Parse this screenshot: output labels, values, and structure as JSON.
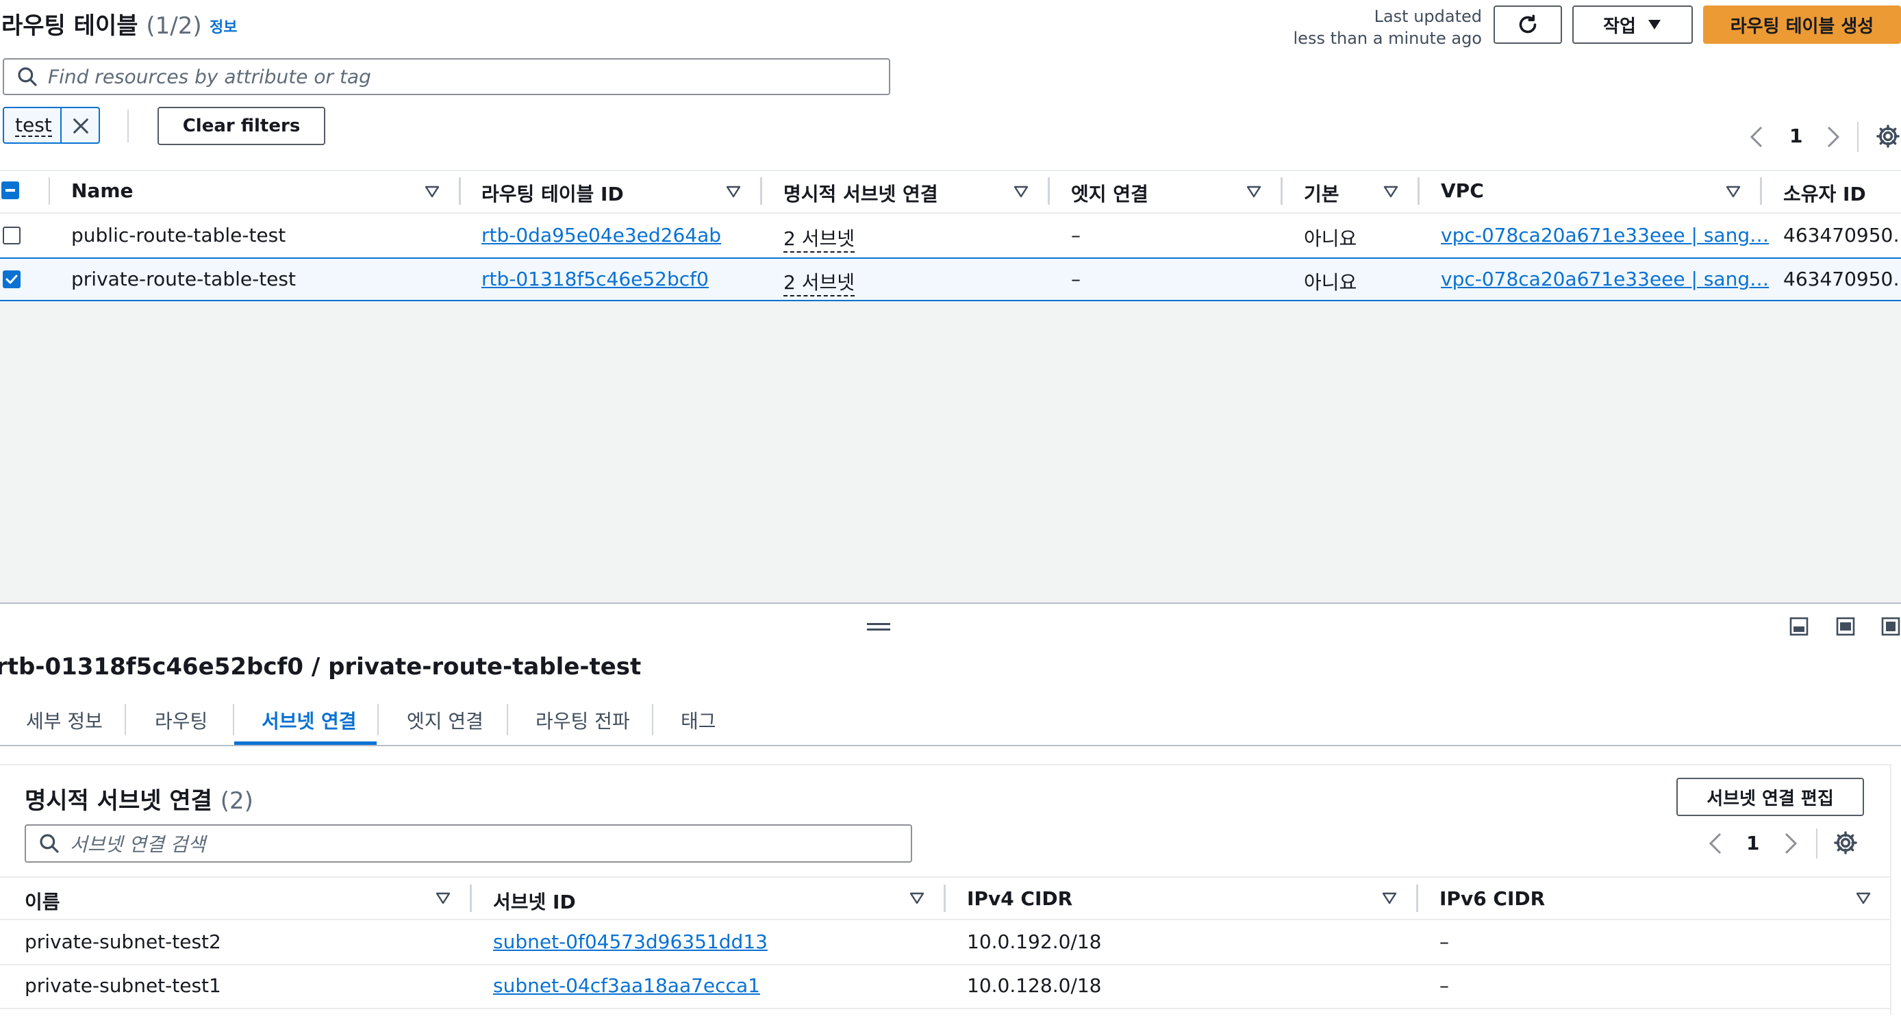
{
  "header": {
    "title": "라우팅 테이블",
    "count": "(1/2)",
    "info_link": "정보",
    "last_updated_label": "Last updated",
    "last_updated_value": "less than a minute ago",
    "actions_label": "작업",
    "create_label": "라우팅 테이블 생성"
  },
  "search": {
    "placeholder": "Find resources by attribute or tag"
  },
  "filter": {
    "token": "test",
    "clear_label": "Clear filters"
  },
  "pagination": {
    "page": "1"
  },
  "table": {
    "columns": [
      "Name",
      "라우팅 테이블 ID",
      "명시적 서브넷 연결",
      "엣지 연결",
      "기본",
      "VPC",
      "소유자 ID"
    ],
    "rows": [
      {
        "name": "public-route-table-test",
        "id": "rtb-0da95e04e3ed264ab",
        "subnets": "2 서브넷",
        "edge": "–",
        "main": "아니요",
        "vpc": "vpc-078ca20a671e33eee | sang…",
        "owner": "463470950…",
        "selected": false
      },
      {
        "name": "private-route-table-test",
        "id": "rtb-01318f5c46e52bcf0",
        "subnets": "2 서브넷",
        "edge": "–",
        "main": "아니요",
        "vpc": "vpc-078ca20a671e33eee | sang…",
        "owner": "463470950…",
        "selected": true
      }
    ]
  },
  "detail": {
    "title": "rtb-01318f5c46e52bcf0 / private-route-table-test",
    "tabs": [
      "세부 정보",
      "라우팅",
      "서브넷 연결",
      "엣지 연결",
      "라우팅 전파",
      "태그"
    ],
    "active_tab": "서브넷 연결",
    "section_title": "명시적 서브넷 연결",
    "section_count": "(2)",
    "edit_label": "서브넷 연결 편집",
    "search_placeholder": "서브넷 연결 검색",
    "page": "1",
    "columns": [
      "이름",
      "서브넷 ID",
      "IPv4 CIDR",
      "IPv6 CIDR"
    ],
    "rows": [
      {
        "name": "private-subnet-test2",
        "subnet_id": "subnet-0f04573d96351dd13",
        "ipv4": "10.0.192.0/18",
        "ipv6": "–"
      },
      {
        "name": "private-subnet-test1",
        "subnet_id": "subnet-04cf3aa18aa7ecca1",
        "ipv4": "10.0.128.0/18",
        "ipv6": "–"
      }
    ]
  },
  "colors": {
    "primary": "#ec9a34",
    "link": "#0972d3",
    "selected_row": "#f2f8fd",
    "selected_border": "#0972d3"
  }
}
